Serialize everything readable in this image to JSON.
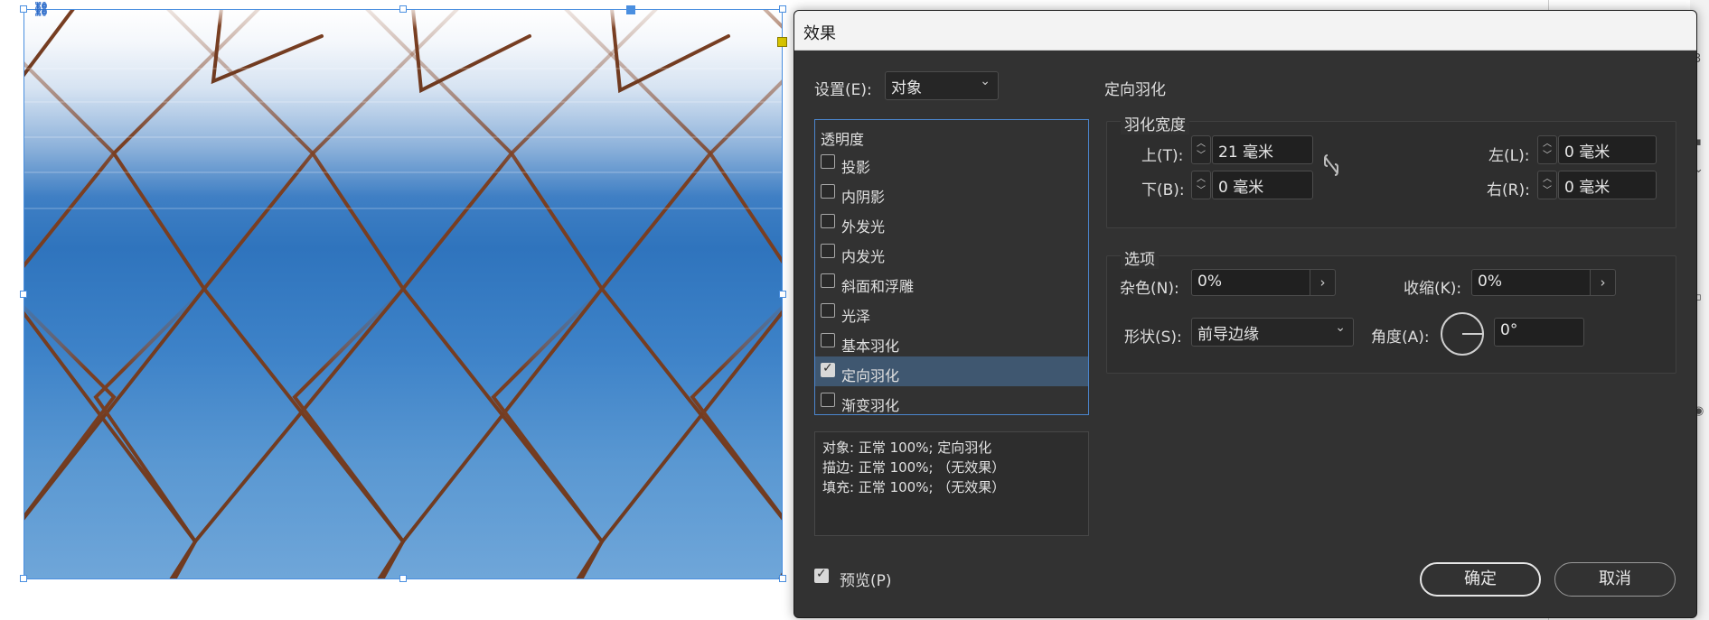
{
  "dialog": {
    "title": "效果",
    "settings_label": "设置(E):",
    "settings_value": "对象",
    "section_title": "定向羽化",
    "effects_header": "透明度",
    "effects": [
      {
        "label": "投影",
        "checked": false
      },
      {
        "label": "内阴影",
        "checked": false
      },
      {
        "label": "外发光",
        "checked": false
      },
      {
        "label": "内发光",
        "checked": false
      },
      {
        "label": "斜面和浮雕",
        "checked": false
      },
      {
        "label": "光泽",
        "checked": false
      },
      {
        "label": "基本羽化",
        "checked": false
      },
      {
        "label": "定向羽化",
        "checked": true,
        "selected": true
      },
      {
        "label": "渐变羽化",
        "checked": false
      }
    ],
    "summary": [
      "对象: 正常 100%; 定向羽化",
      "描边: 正常 100%; （无效果）",
      "填充: 正常 100%; （无效果）"
    ],
    "feather_width": {
      "title": "羽化宽度",
      "top_label": "上(T):",
      "top_value": "21 毫米",
      "bottom_label": "下(B):",
      "bottom_value": "0 毫米",
      "left_label": "左(L):",
      "left_value": "0 毫米",
      "right_label": "右(R):",
      "right_value": "0 毫米"
    },
    "options": {
      "title": "选项",
      "noise_label": "杂色(N):",
      "noise_value": "0%",
      "choke_label": "收缩(K):",
      "choke_value": "0%",
      "shape_label": "形状(S):",
      "shape_value": "前导边缘",
      "angle_label": "角度(A):",
      "angle_value": "0°"
    },
    "preview_label": "预览(P)",
    "preview_checked": true,
    "ok_label": "确定",
    "cancel_label": "取消"
  },
  "colors": {
    "dialog_bg": "#323232",
    "selection_blue": "#4a8fe0",
    "active_row": "#3f5770",
    "anchor_yellow": "#d6c400"
  }
}
